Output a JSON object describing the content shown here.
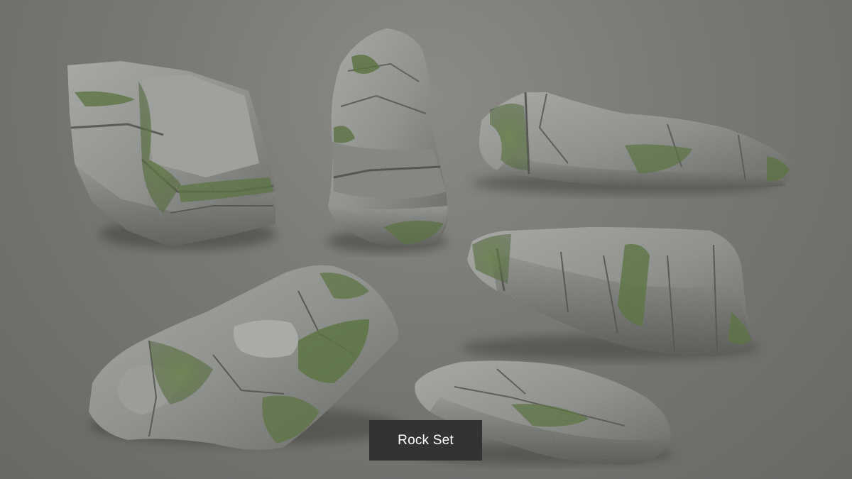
{
  "scene": {
    "background_color": "#7d7b78",
    "rock_color": "#8a8c88",
    "moss_color": "#55703a",
    "rocks": [
      {
        "name": "blocky-rock-icon"
      },
      {
        "name": "tall-rock-icon"
      },
      {
        "name": "long-rock-icon"
      },
      {
        "name": "slab-rock-icon"
      },
      {
        "name": "flat-rock-cluster-icon"
      },
      {
        "name": "flat-stone-icon"
      }
    ]
  },
  "caption": {
    "label": "Rock Set",
    "background": "#333333",
    "text_color": "#ffffff"
  }
}
